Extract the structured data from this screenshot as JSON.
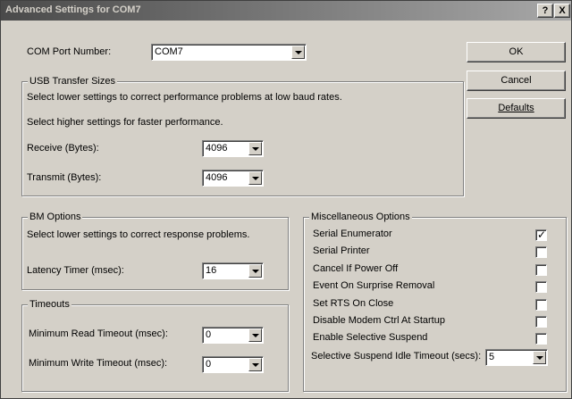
{
  "window": {
    "title": "Advanced Settings for COM7",
    "help_btn": "?",
    "close_btn": "X"
  },
  "com_port": {
    "label": "COM Port Number:",
    "value": "COM7"
  },
  "buttons": {
    "ok": "OK",
    "cancel": "Cancel",
    "defaults": "Defaults"
  },
  "usb": {
    "title": "USB Transfer Sizes",
    "desc1": "Select lower settings to correct performance problems at low baud rates.",
    "desc2": "Select higher settings for faster performance.",
    "receive_label": "Receive (Bytes):",
    "receive_value": "4096",
    "transmit_label": "Transmit (Bytes):",
    "transmit_value": "4096"
  },
  "bm": {
    "title": "BM Options",
    "desc": "Select lower settings to correct response problems.",
    "latency_label": "Latency Timer (msec):",
    "latency_value": "16"
  },
  "timeouts": {
    "title": "Timeouts",
    "read_label": "Minimum Read Timeout (msec):",
    "read_value": "0",
    "write_label": "Minimum Write Timeout (msec):",
    "write_value": "0"
  },
  "misc": {
    "title": "Miscellaneous Options",
    "items": [
      {
        "label": "Serial Enumerator",
        "checked": true,
        "mark": "✓"
      },
      {
        "label": "Serial Printer",
        "checked": false,
        "mark": ""
      },
      {
        "label": "Cancel If Power Off",
        "checked": false,
        "mark": ""
      },
      {
        "label": "Event On Surprise Removal",
        "checked": false,
        "mark": ""
      },
      {
        "label": "Set RTS On Close",
        "checked": false,
        "mark": ""
      },
      {
        "label": "Disable Modem Ctrl At Startup",
        "checked": false,
        "mark": ""
      },
      {
        "label": "Enable Selective Suspend",
        "checked": false,
        "mark": ""
      }
    ],
    "idle_label": "Selective Suspend Idle Timeout (secs):",
    "idle_value": "5"
  }
}
